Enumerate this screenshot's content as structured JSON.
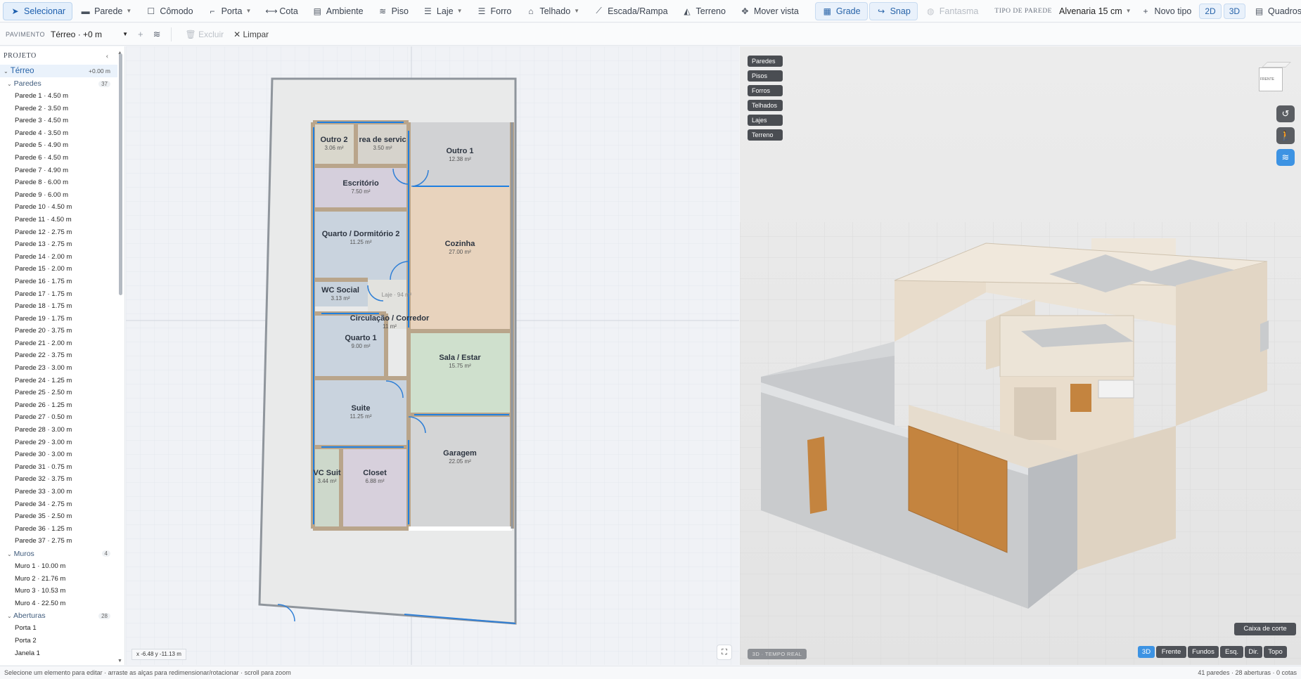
{
  "toolbar": {
    "tools": [
      {
        "label": "Selecionar",
        "icon": "cursor-icon",
        "glyph": "➤",
        "state": "active"
      },
      {
        "label": "Parede",
        "icon": "wall-icon",
        "glyph": "▬",
        "caret": true
      },
      {
        "label": "Cômodo",
        "icon": "room-icon",
        "glyph": "☐"
      },
      {
        "label": "Porta",
        "icon": "door-icon",
        "glyph": "⌐",
        "caret": true
      },
      {
        "label": "Cota",
        "icon": "dimension-icon",
        "glyph": "⟷"
      },
      {
        "label": "Ambiente",
        "icon": "ambient-icon",
        "glyph": "▤"
      },
      {
        "label": "Piso",
        "icon": "floor-icon",
        "glyph": "≋"
      },
      {
        "label": "Laje",
        "icon": "slab-icon",
        "glyph": "☰",
        "caret": true
      },
      {
        "label": "Forro",
        "icon": "ceiling-icon",
        "glyph": "☰"
      },
      {
        "label": "Telhado",
        "icon": "roof-icon",
        "glyph": "⌂",
        "caret": true
      },
      {
        "label": "Escada/Rampa",
        "icon": "stairs-icon",
        "glyph": "⟋"
      },
      {
        "label": "Terreno",
        "icon": "terrain-icon",
        "glyph": "◭"
      },
      {
        "label": "Mover vista",
        "icon": "move-icon",
        "glyph": "✥"
      }
    ],
    "grid_label": "Grade",
    "snap_label": "Snap",
    "ghost_label": "Fantasma",
    "wall_type_label": "TIPO DE PAREDE",
    "wall_type_value": "Alvenaria 15 cm",
    "new_type_label": "Novo tipo",
    "view_2d": "2D",
    "view_3d": "3D",
    "frames_label": "Quadros"
  },
  "subbar": {
    "floor_label": "PAVIMENTO",
    "floor_value": "Térreo · +0 m",
    "delete_label": "Excluir",
    "clear_label": "Limpar"
  },
  "sidebar": {
    "title": "PROJETO",
    "floor": {
      "name": "Térreo",
      "elevation": "+0.00 m"
    },
    "groups": [
      {
        "name": "Paredes",
        "count": "37",
        "items": [
          "Parede 1 · 4.50 m",
          "Parede 2 · 3.50 m",
          "Parede 3 · 4.50 m",
          "Parede 4 · 3.50 m",
          "Parede 5 · 4.90 m",
          "Parede 6 · 4.50 m",
          "Parede 7 · 4.90 m",
          "Parede 8 · 6.00 m",
          "Parede 9 · 6.00 m",
          "Parede 10 · 4.50 m",
          "Parede 11 · 4.50 m",
          "Parede 12 · 2.75 m",
          "Parede 13 · 2.75 m",
          "Parede 14 · 2.00 m",
          "Parede 15 · 2.00 m",
          "Parede 16 · 1.75 m",
          "Parede 17 · 1.75 m",
          "Parede 18 · 1.75 m",
          "Parede 19 · 1.75 m",
          "Parede 20 · 3.75 m",
          "Parede 21 · 2.00 m",
          "Parede 22 · 3.75 m",
          "Parede 23 · 3.00 m",
          "Parede 24 · 1.25 m",
          "Parede 25 · 2.50 m",
          "Parede 26 · 1.25 m",
          "Parede 27 · 0.50 m",
          "Parede 28 · 3.00 m",
          "Parede 29 · 3.00 m",
          "Parede 30 · 3.00 m",
          "Parede 31 · 0.75 m",
          "Parede 32 · 3.75 m",
          "Parede 33 · 3.00 m",
          "Parede 34 · 2.75 m",
          "Parede 35 · 2.50 m",
          "Parede 36 · 1.25 m",
          "Parede 37 · 2.75 m"
        ]
      },
      {
        "name": "Muros",
        "count": "4",
        "items": [
          "Muro 1 · 10.00 m",
          "Muro 2 · 21.76 m",
          "Muro 3 · 10.53 m",
          "Muro 4 · 22.50 m"
        ]
      },
      {
        "name": "Aberturas",
        "count": "28",
        "items": [
          "Porta 1",
          "Porta 2",
          "Janela 1"
        ]
      }
    ]
  },
  "plan": {
    "rooms": [
      {
        "name": "Outro 2",
        "area": "3.06 m²"
      },
      {
        "name": "rea de servic",
        "area": "3.50 m²"
      },
      {
        "name": "Outro 1",
        "area": "12.38 m²"
      },
      {
        "name": "Escritório",
        "area": "7.50 m²"
      },
      {
        "name": "Quarto / Dormitório 2",
        "area": "11.25 m²"
      },
      {
        "name": "Cozinha",
        "area": "27.00 m²"
      },
      {
        "name": "WC Social",
        "area": "3.13 m²"
      },
      {
        "name": "Circulação / Corredor",
        "area": "11 m²"
      },
      {
        "name": "Quarto  1",
        "area": "9.00 m²"
      },
      {
        "name": "Sala / Estar",
        "area": "15.75 m²"
      },
      {
        "name": "Suite",
        "area": "11.25 m²"
      },
      {
        "name": "Garagem",
        "area": "22.05 m²"
      },
      {
        "name": "VC Suit",
        "area": "3.44 m²"
      },
      {
        "name": "Closet",
        "area": "6.88 m²"
      }
    ],
    "slab_label": "Laje · 94 m²",
    "coords": "x -6.48  y -11.13 m"
  },
  "view3d": {
    "layers": [
      "Paredes",
      "Pisos",
      "Forros",
      "Telhados",
      "Lajes",
      "Terreno"
    ],
    "section_box": "Caixa de corte",
    "mode_badge": "3D · TEMPO REAL",
    "cameras": [
      "3D",
      "Frente",
      "Fundos",
      "Esq.",
      "Dir.",
      "Topo"
    ],
    "cube_label": "FRENTE"
  },
  "status": {
    "hint": "Selecione um elemento para editar · arraste as alças para redimensionar/rotacionar · scroll para zoom",
    "summary": "41 paredes · 28 aberturas · 0 cotas"
  },
  "colors": {
    "accent": "#2f7fd6",
    "wall_blue": "#1e7fe0",
    "door_wood": "#c4843f"
  }
}
